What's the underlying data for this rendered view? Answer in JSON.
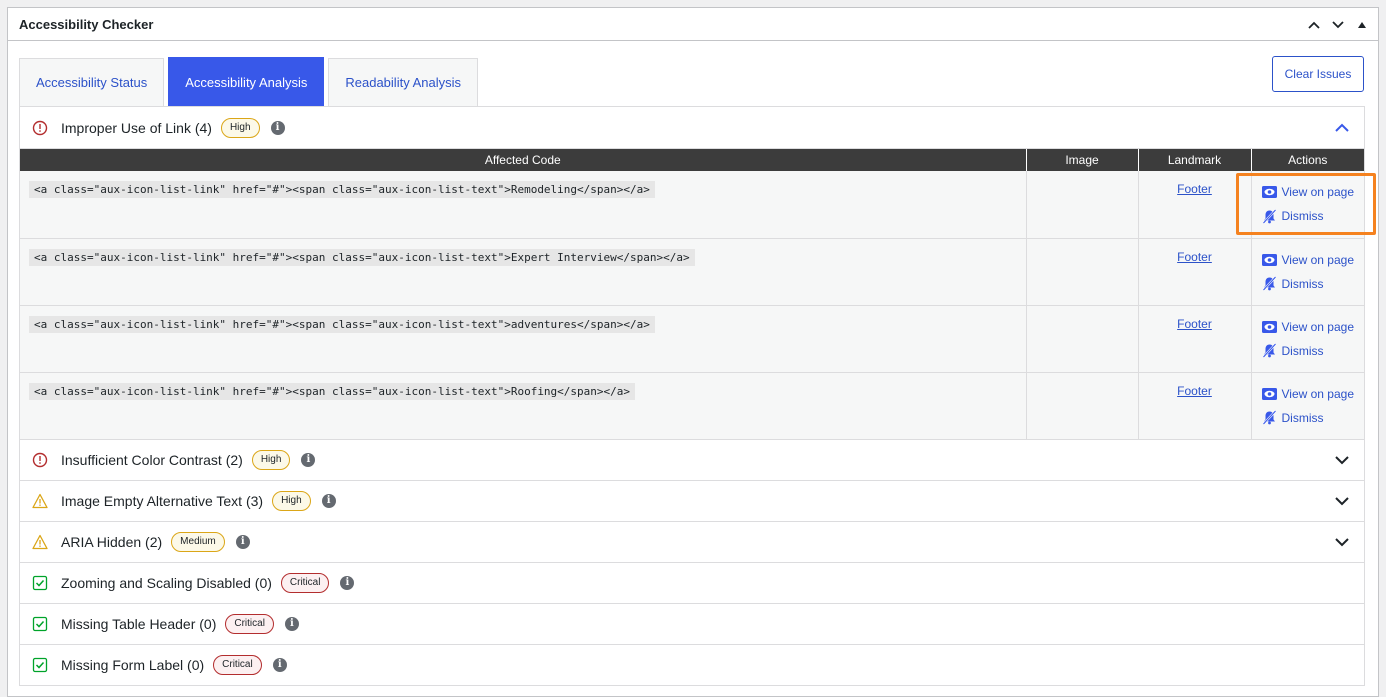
{
  "panel": {
    "title": "Accessibility Checker"
  },
  "tabs": [
    {
      "label": "Accessibility Status",
      "active": false
    },
    {
      "label": "Accessibility Analysis",
      "active": true
    },
    {
      "label": "Readability Analysis",
      "active": false
    }
  ],
  "clear_button": "Clear Issues",
  "table": {
    "headers": [
      "Affected Code",
      "Image",
      "Landmark",
      "Actions"
    ],
    "rows": [
      {
        "code": "<a class=\"aux-icon-list-link\" href=\"#\"><span class=\"aux-icon-list-text\">Remodeling</span></a>",
        "image": "",
        "landmark": "Footer",
        "view": "View on page",
        "dismiss": "Dismiss"
      },
      {
        "code": "<a class=\"aux-icon-list-link\" href=\"#\"><span class=\"aux-icon-list-text\">Expert Interview</span></a>",
        "image": "",
        "landmark": "Footer",
        "view": "View on page",
        "dismiss": "Dismiss"
      },
      {
        "code": "<a class=\"aux-icon-list-link\" href=\"#\"><span class=\"aux-icon-list-text\">adventures</span></a>",
        "image": "",
        "landmark": "Footer",
        "view": "View on page",
        "dismiss": "Dismiss"
      },
      {
        "code": "<a class=\"aux-icon-list-link\" href=\"#\"><span class=\"aux-icon-list-text\">Roofing</span></a>",
        "image": "",
        "landmark": "Footer",
        "view": "View on page",
        "dismiss": "Dismiss"
      }
    ]
  },
  "issues": [
    {
      "title": "Improper Use of Link (4)",
      "badge": "High",
      "status": "error",
      "expanded": true
    },
    {
      "title": "Insufficient Color Contrast (2)",
      "badge": "High",
      "status": "error",
      "expanded": false
    },
    {
      "title": "Image Empty Alternative Text (3)",
      "badge": "High",
      "status": "warning",
      "expanded": false
    },
    {
      "title": "ARIA Hidden (2)",
      "badge": "Medium",
      "status": "warning",
      "expanded": false
    },
    {
      "title": "Zooming and Scaling Disabled (0)",
      "badge": "Critical",
      "status": "pass",
      "expanded": false
    },
    {
      "title": "Missing Table Header (0)",
      "badge": "Critical",
      "status": "pass",
      "expanded": false
    },
    {
      "title": "Missing Form Label (0)",
      "badge": "Critical",
      "status": "pass",
      "expanded": false
    }
  ],
  "info_glyph": "i",
  "colors": {
    "accent": "#3858e9",
    "link": "#2c52c9",
    "error": "#b32d2e",
    "warning": "#dba617",
    "pass": "#00a32a",
    "highlight": "#f5821f"
  }
}
